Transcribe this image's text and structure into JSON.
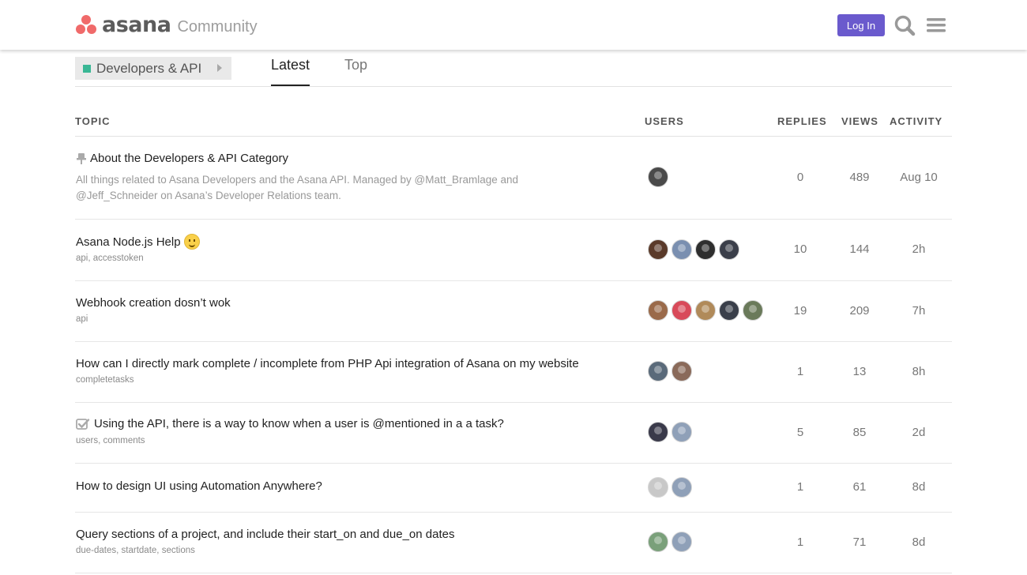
{
  "header": {
    "brand": "asana",
    "brand_suffix": "Community",
    "login_label": "Log In",
    "search_icon": "search-icon",
    "menu_icon": "hamburger-menu-icon",
    "accent_color": "#6a5acd",
    "logo_color": "#f06a6a"
  },
  "nav": {
    "category": "Developers & API",
    "category_color": "#3ab795",
    "tabs": [
      {
        "label": "Latest",
        "active": true
      },
      {
        "label": "Top",
        "active": false
      }
    ]
  },
  "table": {
    "headers": {
      "topic": "TOPIC",
      "users": "USERS",
      "replies": "REPLIES",
      "views": "VIEWS",
      "activity": "ACTIVITY"
    },
    "rows": [
      {
        "title": "About the Developers & API Category",
        "pinned": true,
        "excerpt": "All things related to Asana Developers and the Asana API. Managed by @Matt_Bramlage and @Jeff_Schneider on Asana’s Developer Relations team.",
        "tags": [],
        "avatar_colors": [
          "#4a4a4a"
        ],
        "replies": "0",
        "views": "489",
        "activity": "Aug 10"
      },
      {
        "title": "Asana Node.js Help",
        "emoji": "slightly-smiling-face-icon",
        "tags": [
          "api",
          "accesstoken"
        ],
        "avatar_colors": [
          "#5a3a2a",
          "#7a8fb0",
          "#2e2e2e",
          "#3b3f4a"
        ],
        "replies": "10",
        "views": "144",
        "activity": "2h"
      },
      {
        "title": "Webhook creation dosn’t wok",
        "tags": [
          "api"
        ],
        "avatar_colors": [
          "#9a6a4a",
          "#d84a5a",
          "#b08a5a",
          "#3a3f4a",
          "#6a7a5a"
        ],
        "replies": "19",
        "views": "209",
        "activity": "7h"
      },
      {
        "title": "How can I directly mark complete / incomplete from PHP Api integration of Asana on my website",
        "tags": [
          "completetasks"
        ],
        "avatar_colors": [
          "#5a6a7a",
          "#8a6a5a"
        ],
        "replies": "1",
        "views": "13",
        "activity": "8h"
      },
      {
        "title": "Using the API, there is a way to know when a user is @mentioned in a a task?",
        "solved": true,
        "tags": [
          "users",
          "comments"
        ],
        "avatar_colors": [
          "#3a3a4a",
          "#8fa0b8"
        ],
        "replies": "5",
        "views": "85",
        "activity": "2d"
      },
      {
        "title": "How to design UI using Automation Anywhere?",
        "tags": [],
        "avatar_colors": [
          "#c8c8c8",
          "#8fa0b8"
        ],
        "replies": "1",
        "views": "61",
        "activity": "8d"
      },
      {
        "title": "Query sections of a project, and include their start_on and due_on dates",
        "tags": [
          "due-dates",
          "startdate",
          "sections"
        ],
        "avatar_colors": [
          "#7aa07a",
          "#8fa0b8"
        ],
        "replies": "1",
        "views": "71",
        "activity": "8d"
      }
    ]
  }
}
